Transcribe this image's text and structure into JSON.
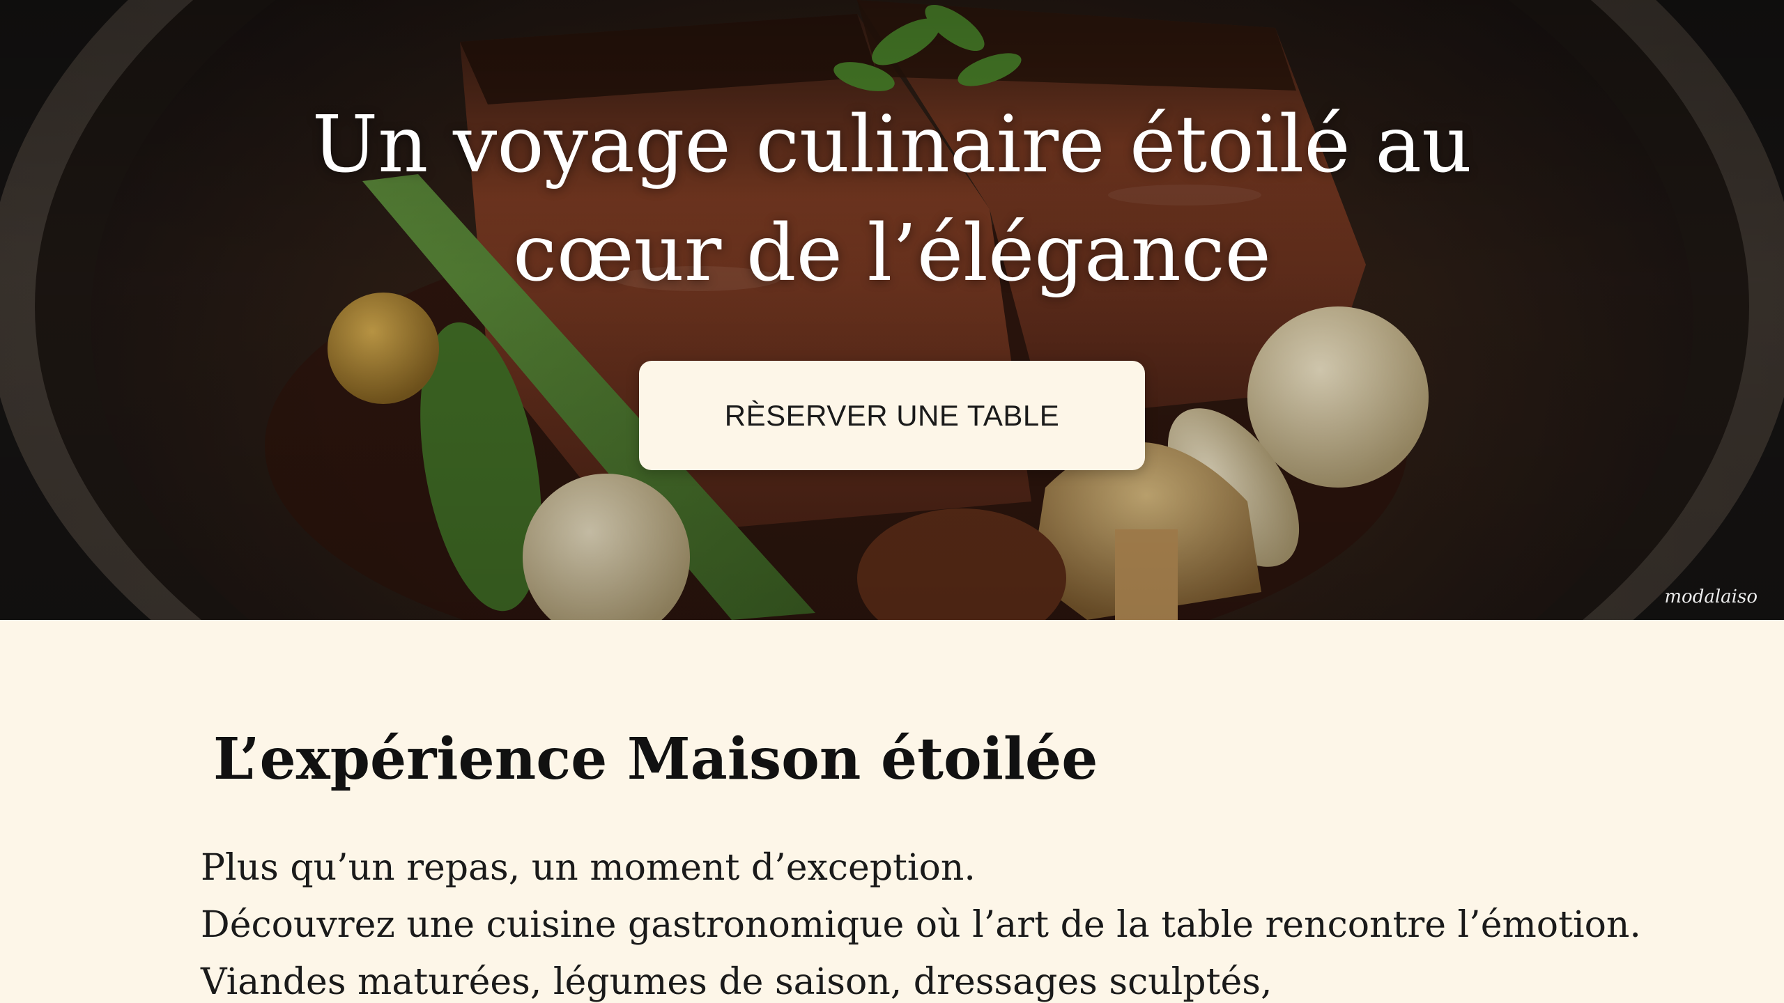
{
  "hero": {
    "title_line1": "Un voyage culinaire étoilé au",
    "title_line2": "cœur de l’élégance",
    "cta_label": "RÈSERVER UNE TABLE",
    "watermark": "modalaiso",
    "image_subject": "plated-meat-dish-with-vegetables"
  },
  "experience": {
    "heading": "L’expérience Maison étoilée",
    "lines": [
      "Plus qu’un repas, un moment d’exception.",
      "Découvrez une cuisine gastronomique où l’art de la table rencontre l’émotion.",
      "Viandes maturées, légumes de saison, dressages sculptés,"
    ]
  },
  "colors": {
    "cream_background": "#fdf6e8",
    "button_background": "#fdf6e8",
    "hero_text": "#ffffff",
    "body_text": "#1a1a1a"
  }
}
